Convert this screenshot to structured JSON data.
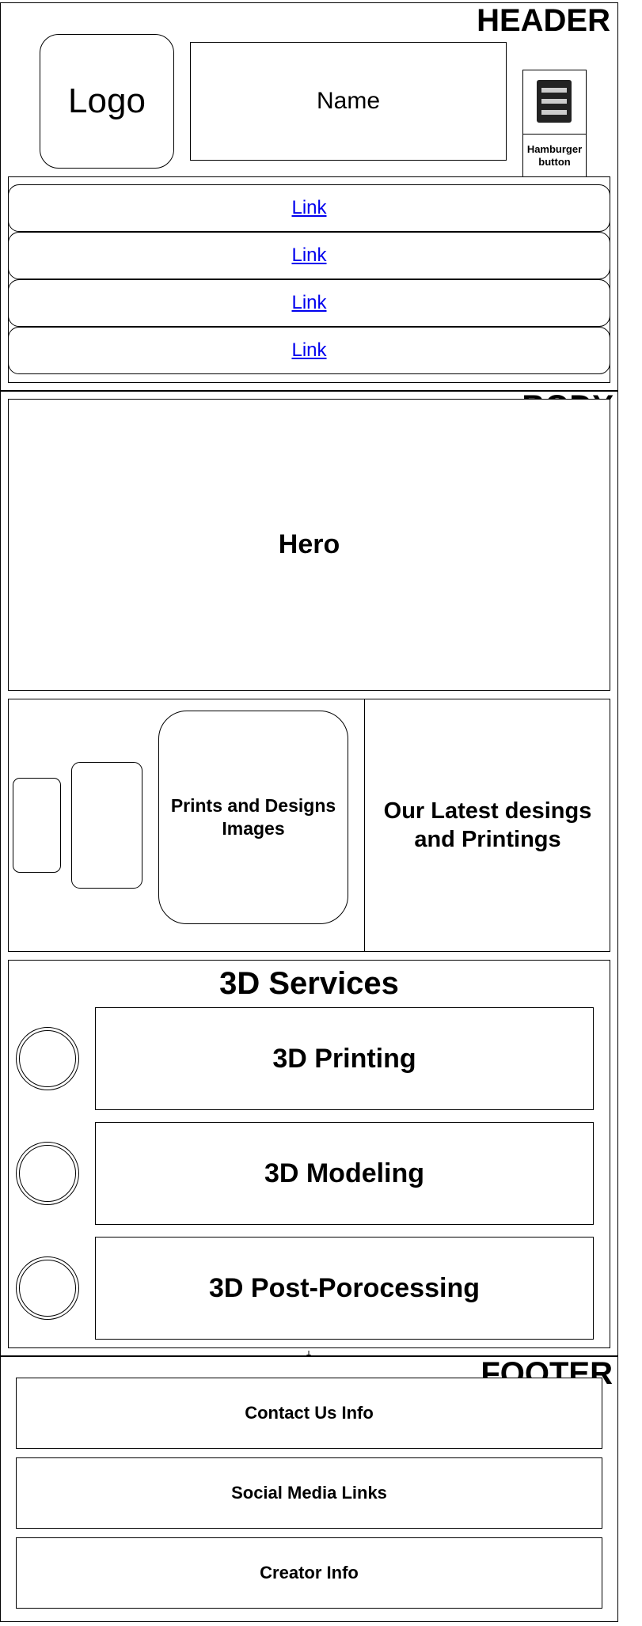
{
  "header": {
    "title": "HEADER",
    "logo": "Logo",
    "name": "Name",
    "hamburger": {
      "icon": "hamburger-menu-icon",
      "label": "Hamburger button"
    },
    "links": [
      "Link",
      "Link",
      "Link",
      "Link"
    ]
  },
  "body": {
    "title": "BODY",
    "hero": "Hero",
    "gallery": {
      "main_image_label": "Prints and Designs Images",
      "tagline": "Our Latest desings and Printings"
    },
    "services": {
      "title": "3D Services",
      "items": [
        "3D Printing",
        "3D Modeling",
        "3D Post-Porocessing"
      ]
    }
  },
  "footer": {
    "title": "FOOTER",
    "items": [
      "Contact Us Info",
      "Social Media Links",
      "Creator Info"
    ]
  },
  "colors": {
    "link": "#0000ee",
    "icon_dark": "#222222",
    "icon_bar": "#cccccc"
  }
}
